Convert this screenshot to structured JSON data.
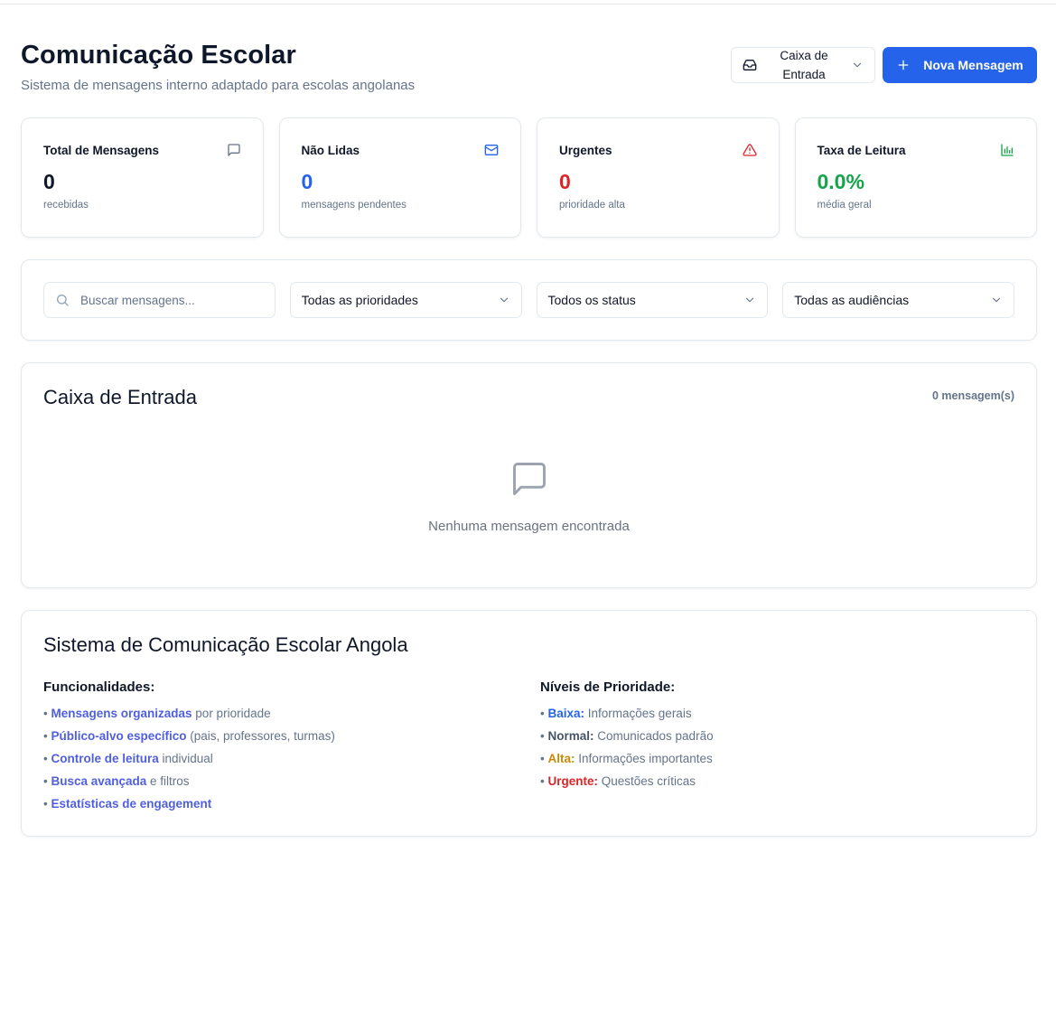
{
  "header": {
    "title": "Comunicação Escolar",
    "subtitle": "Sistema de mensagens interno adaptado para escolas angolanas",
    "folder_select": "Caixa de Entrada",
    "new_button": "Nova Mensagem"
  },
  "stats": [
    {
      "title": "Total de Mensagens",
      "value": "0",
      "desc": "recebidas",
      "icon": "message-square-icon",
      "color": "#0f172a"
    },
    {
      "title": "Não Lidas",
      "value": "0",
      "desc": "mensagens pendentes",
      "icon": "mail-icon",
      "color": "#2563eb"
    },
    {
      "title": "Urgentes",
      "value": "0",
      "desc": "prioridade alta",
      "icon": "alert-triangle-icon",
      "color": "#dc2626"
    },
    {
      "title": "Taxa de Leitura",
      "value": "0.0%",
      "desc": "média geral",
      "icon": "bar-chart-icon",
      "color": "#16a34a"
    }
  ],
  "filters": {
    "search_placeholder": "Buscar mensagens...",
    "priority": "Todas as prioridades",
    "status": "Todos os status",
    "audience": "Todas as audiências"
  },
  "inbox": {
    "title": "Caixa de Entrada",
    "count": "0 mensagem(s)",
    "empty_text": "Nenhuma mensagem encontrada"
  },
  "info": {
    "title": "Sistema de Comunicação Escolar Angola",
    "features_title": "Funcionalidades:",
    "features": [
      {
        "hl": "Mensagens organizadas",
        "rest": " por prioridade"
      },
      {
        "hl": "Público-alvo específico",
        "rest": " (pais, professores, turmas)"
      },
      {
        "hl": "Controle de leitura",
        "rest": " individual"
      },
      {
        "hl": "Busca avançada",
        "rest": " e filtros"
      },
      {
        "hl": "Estatísticas de engagement",
        "rest": ""
      }
    ],
    "levels_title": "Níveis de Prioridade:",
    "levels": [
      {
        "hl": "Baixa:",
        "rest": " Informações gerais",
        "color": "#2563eb"
      },
      {
        "hl": "Normal:",
        "rest": " Comunicados padrão",
        "color": "#475569"
      },
      {
        "hl": "Alta:",
        "rest": " Informações importantes",
        "color": "#ca8a04"
      },
      {
        "hl": "Urgente:",
        "rest": " Questões críticas",
        "color": "#dc2626"
      }
    ]
  }
}
